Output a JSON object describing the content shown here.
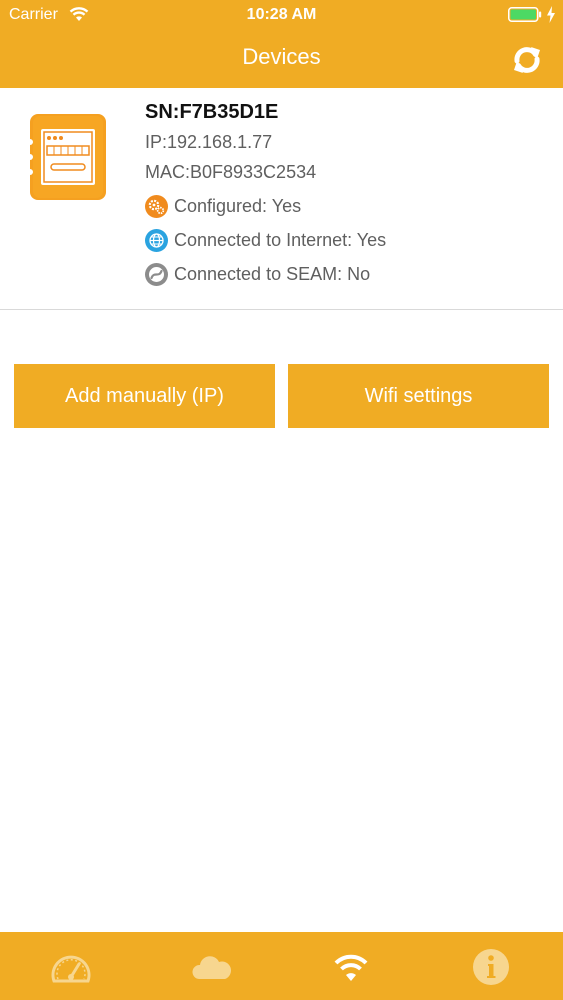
{
  "status_bar": {
    "carrier": "Carrier",
    "time": "10:28 AM",
    "icons": [
      "wifi-icon",
      "battery-icon",
      "charging-icon"
    ]
  },
  "header": {
    "title": "Devices",
    "refresh_icon": "refresh-icon"
  },
  "device": {
    "icon": "meter-device-icon",
    "sn": "SN:F7B35D1E",
    "ip": "IP:192.168.1.77",
    "mac": "MAC:B0F8933C2534",
    "statuses": [
      {
        "icon": "gears-icon",
        "text": "Configured: Yes",
        "color": "#F08B1E"
      },
      {
        "icon": "globe-icon",
        "text": "Connected to Internet: Yes",
        "color": "#2AA3E0"
      },
      {
        "icon": "seam-icon",
        "text": "Connected to SEAM: No",
        "color": "#8C8C8C"
      }
    ]
  },
  "buttons": {
    "add_manually": "Add manually (IP)",
    "wifi_settings": "Wifi settings"
  },
  "tabbar": {
    "tabs": [
      {
        "icon": "dashboard-icon",
        "active": false
      },
      {
        "icon": "cloud-icon",
        "active": false
      },
      {
        "icon": "wifi-icon",
        "active": true
      },
      {
        "icon": "info-icon",
        "active": false
      }
    ]
  },
  "colors": {
    "accent": "#F0AC24",
    "tab_inactive": "#F7D68F",
    "tab_active": "#FFFFFF"
  }
}
